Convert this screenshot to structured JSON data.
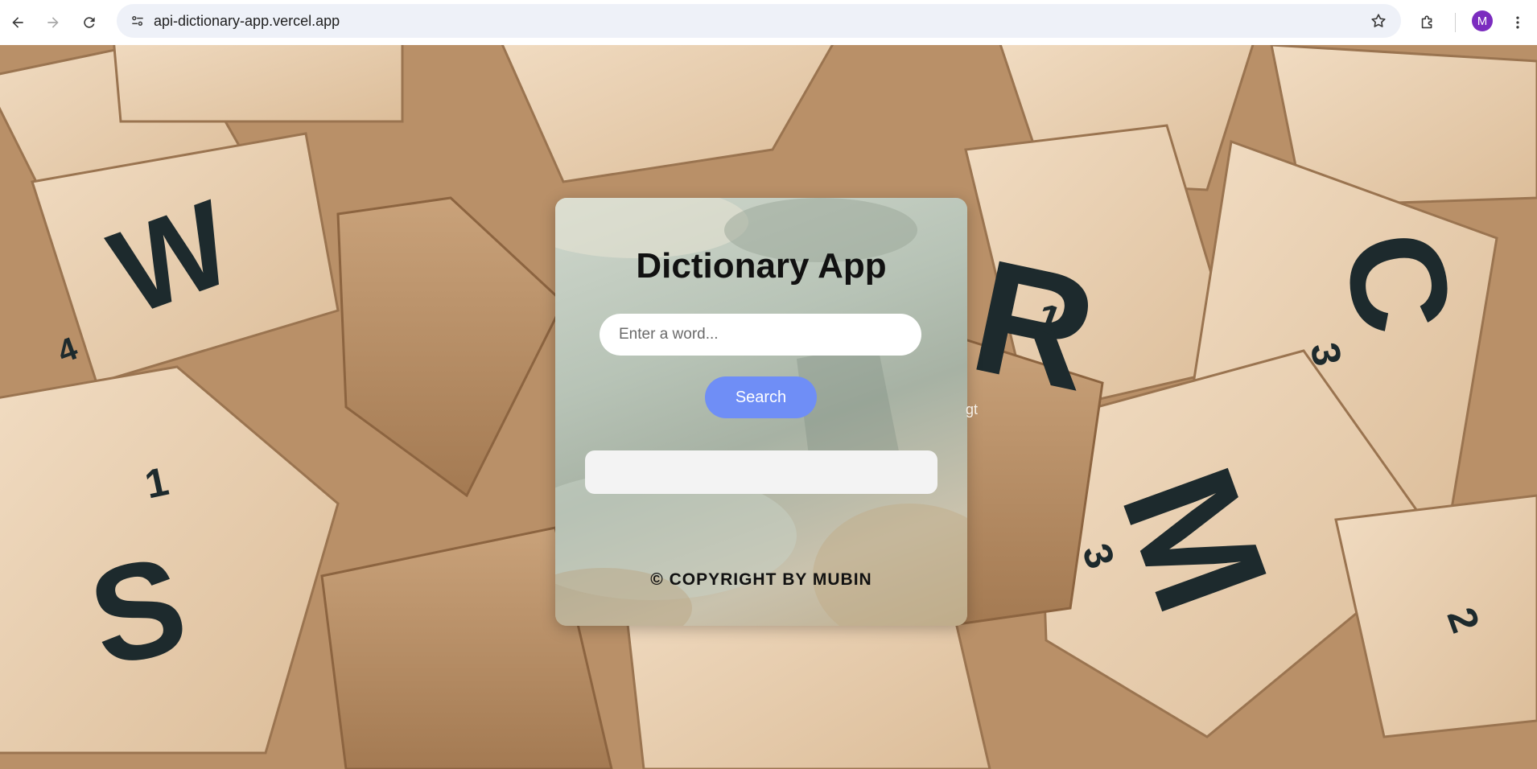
{
  "browser": {
    "url": "api-dictionary-app.vercel.app",
    "profile_initial": "M",
    "icons": {
      "back": "back-arrow-icon",
      "forward": "forward-arrow-icon",
      "reload": "reload-icon",
      "site_info": "site-info-icon",
      "bookmark": "star-icon",
      "extensions": "puzzle-icon",
      "menu": "kebab-menu-icon"
    }
  },
  "app": {
    "title": "Dictionary App",
    "search": {
      "placeholder": "Enter a word...",
      "value": ""
    },
    "search_button_label": "Search",
    "result_text": "",
    "copyright": "© COPYRIGHT BY MUBIN",
    "stray_text": "gt"
  },
  "colors": {
    "accent_button": "#6f8ef6",
    "avatar": "#7b2cbf"
  }
}
